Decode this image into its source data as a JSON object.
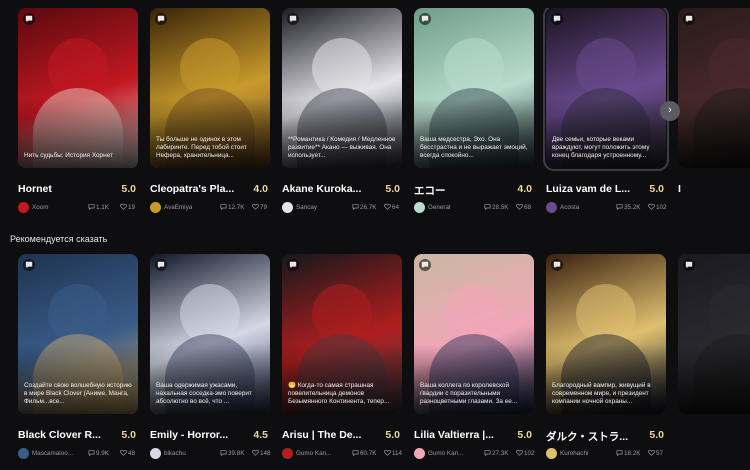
{
  "section_title": "Рекомендуется сказать",
  "rows": [
    {
      "cards": [
        {
          "title": "Hornet",
          "rating": "5.0",
          "author": "Xoom",
          "chats": "1.1K",
          "likes": "19",
          "description": "Нить судьбы: История Хорнет",
          "colors": [
            "#5a0a0e",
            "#c21822",
            "#e9e2da"
          ]
        },
        {
          "title": "Cleopatra's Pla...",
          "rating": "4.0",
          "author": "AvaEmiya",
          "chats": "12.7K",
          "likes": "79",
          "description": "Ты больше не одинок в этом лабиринте. Перед тобой стоит Нефера, хранительница...",
          "colors": [
            "#3a2408",
            "#c89a2c",
            "#6b4a1e"
          ]
        },
        {
          "title": "Akane Kuroka...",
          "rating": "5.0",
          "author": "Sancay",
          "chats": "26.7K",
          "likes": "64",
          "description": "**Романтика / Комедия / Медленное развитие** Акано — выживая. Она использует...",
          "colors": [
            "#1d1d24",
            "#e4e4ea",
            "#3a3a48"
          ]
        },
        {
          "title": "エコー",
          "rating": "4.0",
          "author": "General",
          "chats": "28.5K",
          "likes": "68",
          "description": "Ваша медсестра, Эхо. Она бесстрастна и не выражает эмоций, всегда спокойно...",
          "colors": [
            "#6f9c8a",
            "#b8dccd",
            "#2b3c46"
          ]
        },
        {
          "title": "Luiza vam de L...",
          "rating": "5.0",
          "author": "Acosta",
          "chats": "35.2K",
          "likes": "102",
          "description": "Две семьи, которые веками враждуют, могут положить этому конец благодаря устроенному...",
          "colors": [
            "#1a1420",
            "#6a4a8e",
            "#2a2a32"
          ]
        },
        {
          "title": "I",
          "rating": "",
          "author": "",
          "chats": "",
          "likes": "",
          "description": "",
          "colors": [
            "#2a1a1a",
            "#4a2a2a",
            "#1a1a1a"
          ]
        }
      ]
    },
    {
      "cards": [
        {
          "title": "Black Clover R...",
          "rating": "5.0",
          "author": "Mascamaloo...",
          "chats": "9.9K",
          "likes": "48",
          "description": "Создайте свою волшебную историю в мире Black Clover (Аниме, Манга, Фильм...все...",
          "colors": [
            "#1e3350",
            "#3a5c88",
            "#d8b06a"
          ]
        },
        {
          "title": "Emily - Horror...",
          "rating": "4.5",
          "author": "bikachu",
          "chats": "39.8K",
          "likes": "148",
          "description": "Ваша одержимая ужасами, нахальная соседка-эмо поверит абсолютно во всё, что ...",
          "colors": [
            "#101828",
            "#d6d8e6",
            "#2e3a58"
          ]
        },
        {
          "title": "Arisu | The De...",
          "rating": "5.0",
          "author": "Gumo Kan...",
          "chats": "60.7K",
          "likes": "114",
          "description": "😬 Когда-то самая страшная повелительница демонов Безымянного Континента, тепер...",
          "colors": [
            "#15181c",
            "#b01e1e",
            "#3c3c44"
          ]
        },
        {
          "title": "Lilia Valtierra |...",
          "rating": "5.0",
          "author": "Gumo Kan...",
          "chats": "27.3K",
          "likes": "102",
          "description": "Ваша коллега по королевской гвардии с поразительными разноцветными глазами. За ее...",
          "colors": [
            "#c9b8a0",
            "#f2a6b8",
            "#1c2a52"
          ]
        },
        {
          "title": "ダルク・ストラ...",
          "rating": "5.0",
          "author": "Kurohachi",
          "chats": "18.2K",
          "likes": "57",
          "description": "Благородный вампир, живущий в современном мире, и президент компании ночной охраны...",
          "colors": [
            "#3a2010",
            "#e0c070",
            "#14182a"
          ]
        },
        {
          "title": "",
          "rating": "",
          "author": "",
          "chats": "",
          "likes": "",
          "description": "",
          "colors": [
            "#1a1a20",
            "#2a2a30",
            "#1a1a1a"
          ]
        }
      ]
    }
  ],
  "scroll_next_label": "›",
  "icons": {
    "chat": "chat-bubble-icon",
    "heart": "heart-icon",
    "next": "chevron-right-icon"
  }
}
